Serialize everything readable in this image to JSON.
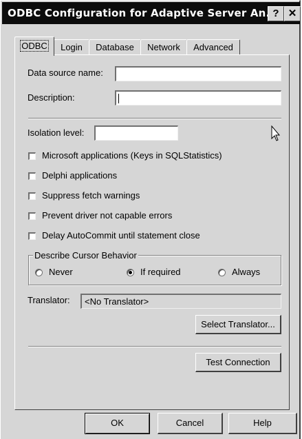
{
  "window": {
    "title": "ODBC Configuration for Adaptive Server An...",
    "help_glyph": "?",
    "close_glyph": "✕"
  },
  "tabs": [
    {
      "label": "ODBC",
      "active": true
    },
    {
      "label": "Login",
      "active": false
    },
    {
      "label": "Database",
      "active": false
    },
    {
      "label": "Network",
      "active": false
    },
    {
      "label": "Advanced",
      "active": false
    }
  ],
  "form": {
    "data_source_name": {
      "label": "Data source name:",
      "value": ""
    },
    "description": {
      "label": "Description:",
      "value": ""
    },
    "isolation_level": {
      "label": "Isolation level:",
      "value": ""
    }
  },
  "checkboxes": [
    {
      "label": "Microsoft applications (Keys in SQLStatistics)",
      "checked": false
    },
    {
      "label": "Delphi applications",
      "checked": false
    },
    {
      "label": "Suppress fetch warnings",
      "checked": false
    },
    {
      "label": "Prevent driver not capable errors",
      "checked": false
    },
    {
      "label": "Delay AutoCommit until statement close",
      "checked": false
    }
  ],
  "cursor_behavior": {
    "legend": "Describe Cursor Behavior",
    "options": [
      {
        "label": "Never",
        "selected": false
      },
      {
        "label": "If required",
        "selected": true
      },
      {
        "label": "Always",
        "selected": false
      }
    ]
  },
  "translator": {
    "label": "Translator:",
    "value": "<No Translator>",
    "select_button": "Select Translator..."
  },
  "test_connection_button": "Test Connection",
  "footer": {
    "ok": "OK",
    "cancel": "Cancel",
    "help": "Help"
  },
  "icons": {
    "pointer": "arrow-cursor-icon"
  }
}
